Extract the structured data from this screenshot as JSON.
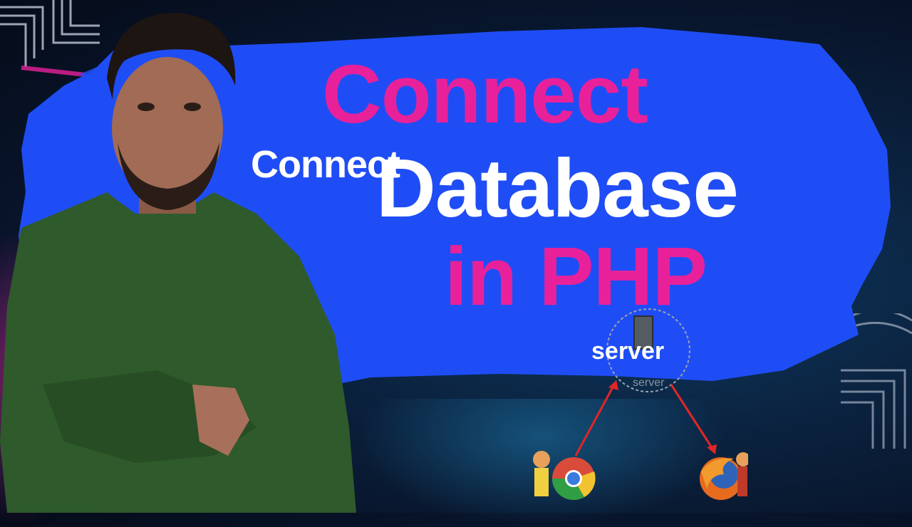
{
  "title": {
    "line1": "Connect",
    "line2_prefix": "Connect",
    "line2": "Database",
    "line3": "in PHP"
  },
  "diagram": {
    "label": "server",
    "server_caption": "server",
    "client_left_icon": "chrome-icon",
    "client_right_icon": "firefox-icon"
  },
  "colors": {
    "banner": "#1f4df5",
    "accent_pink": "#e8219a",
    "text_white": "#ffffff",
    "sweater": "#2f5a2c"
  }
}
